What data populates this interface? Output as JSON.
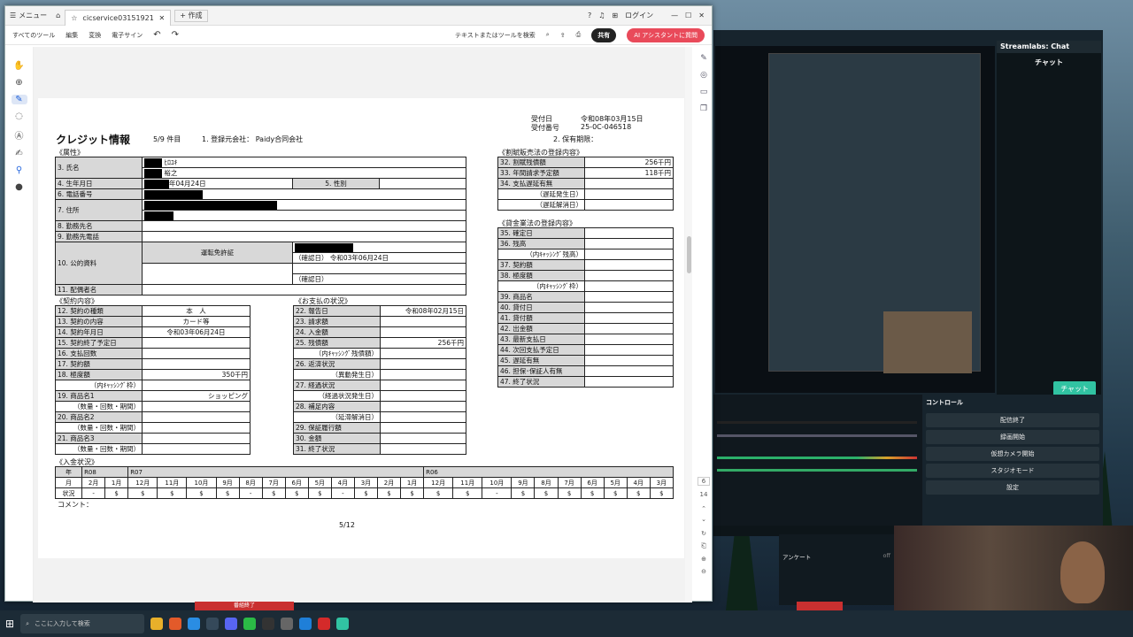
{
  "app": {
    "menu": "メニュー",
    "tab_title": "cicservice031519210...",
    "new_tab": "+ 作成",
    "login": "ログイン"
  },
  "toolbar": {
    "all_tools": "すべてのツール",
    "edit": "編集",
    "convert": "変換",
    "esign": "電子サイン",
    "search": "テキストまたはツールを検索",
    "share": "共有",
    "ai": "AI アシスタントに質問"
  },
  "doc": {
    "title": "クレジット情報",
    "count": "5/9 件目",
    "registrant": "1. 登録元会社： Paidy合同会社",
    "received_date_label": "受付日",
    "received_date": "令和08年03月15日",
    "received_no_label": "受付番号",
    "received_no": "25-0C-046518",
    "retention": "2. 保有期限：",
    "attr_header": "《属性》",
    "name_label": "3. 氏名",
    "name_kana": "ﾋﾛﾕｷ",
    "name_given": "裕之",
    "birth_label": "4. 生年月日",
    "birth": "年04月24日",
    "sex_label": "5. 性別",
    "phone_label": "6. 電話番号",
    "address_label": "7. 住所",
    "work_label": "8. 勤務先名",
    "work_phone_label": "9. 勤務先電話",
    "id_label": "10. 公的資料",
    "id_type": "運転免許証",
    "id_confirm1": "（確認日） 令和03年06月24日",
    "id_confirm2": "（確認日）",
    "spouse_label": "11. 配偶者名",
    "contract_header": "《契約内容》",
    "contract_rows": [
      {
        "k": "12. 契約の種類",
        "v": "本　人",
        "a": "c"
      },
      {
        "k": "13. 契約の内容",
        "v": "カード等",
        "a": "c"
      },
      {
        "k": "14. 契約年月日",
        "v": "令和03年06月24日",
        "a": "c"
      },
      {
        "k": "15. 契約終了予定日",
        "v": "",
        "a": "c"
      },
      {
        "k": "16. 支払回数",
        "v": "",
        "a": "c"
      },
      {
        "k": "17. 契約額",
        "v": "",
        "a": "c"
      },
      {
        "k": "18. 極度額",
        "v": "350千円",
        "a": "r"
      },
      {
        "k": "（内ｷｬｯｼﾝｸﾞ枠）",
        "v": "",
        "a": "r",
        "sub": true
      },
      {
        "k": "19. 商品名1",
        "v": "ショッピング",
        "a": "r"
      },
      {
        "k": "（数量・回数・期間）",
        "v": "",
        "a": "r",
        "sub": true
      },
      {
        "k": "20. 商品名2",
        "v": "",
        "a": "r"
      },
      {
        "k": "（数量・回数・期間）",
        "v": "",
        "a": "r",
        "sub": true
      },
      {
        "k": "21. 商品名3",
        "v": "",
        "a": "r"
      },
      {
        "k": "（数量・回数・期間）",
        "v": "",
        "a": "r",
        "sub": true
      }
    ],
    "payment_header": "《お支払の状況》",
    "payment_rows": [
      {
        "k": "22. 報告日",
        "v": "令和08年02月15日"
      },
      {
        "k": "23. 請求額",
        "v": ""
      },
      {
        "k": "24. 入金額",
        "v": ""
      },
      {
        "k": "25. 残債額",
        "v": "256千円"
      },
      {
        "k": "（内ｷｬｯｼﾝｸﾞ残債額）",
        "v": "",
        "sub": true
      },
      {
        "k": "26. 返済状況",
        "v": ""
      },
      {
        "k": "（異動発生日）",
        "v": "",
        "sub": true
      },
      {
        "k": "27. 経過状況",
        "v": ""
      },
      {
        "k": "（経過状況発生日）",
        "v": "",
        "sub": true
      },
      {
        "k": "28. 補足内容",
        "v": ""
      },
      {
        "k": "（延滞解消日）",
        "v": "",
        "sub": true
      },
      {
        "k": "29. 保証履行額",
        "v": ""
      },
      {
        "k": "30. 金額",
        "v": ""
      },
      {
        "k": "31. 終了状況",
        "v": ""
      }
    ],
    "installment_header": "《割賦販売法の登録内容》",
    "installment_rows": [
      {
        "k": "32. 割賦残債額",
        "v": "256千円"
      },
      {
        "k": "33. 年間請求予定額",
        "v": "118千円"
      },
      {
        "k": "34. 支払遅延有無",
        "v": ""
      },
      {
        "k": "（遅延発生日）",
        "v": "",
        "sub": true
      },
      {
        "k": "（遅延解消日）",
        "v": "",
        "sub": true
      }
    ],
    "lending_header": "《貸金業法の登録内容》",
    "lending_rows": [
      {
        "k": "35. 確定日",
        "v": ""
      },
      {
        "k": "36. 残高",
        "v": ""
      },
      {
        "k": "（内ｷｬｯｼﾝｸﾞ残高）",
        "v": "",
        "sub": true
      },
      {
        "k": "37. 契約額",
        "v": ""
      },
      {
        "k": "38. 極度額",
        "v": ""
      },
      {
        "k": "（内ｷｬｯｼﾝｸﾞ枠）",
        "v": "",
        "sub": true
      },
      {
        "k": "39. 商品名",
        "v": ""
      },
      {
        "k": "40. 貸付日",
        "v": ""
      },
      {
        "k": "41. 貸付額",
        "v": ""
      },
      {
        "k": "42. 出金額",
        "v": ""
      },
      {
        "k": "43. 最新支払日",
        "v": ""
      },
      {
        "k": "44. 次回支払予定日",
        "v": ""
      },
      {
        "k": "45. 遅延有無",
        "v": ""
      },
      {
        "k": "46. 担保･保証人有無",
        "v": ""
      },
      {
        "k": "47. 終了状況",
        "v": ""
      }
    ],
    "deposit_header": "《入金状況》",
    "deposit_year_label": "年",
    "deposit_month_label": "月",
    "deposit_status_label": "状況",
    "years": [
      "R08",
      "R07",
      "R06"
    ],
    "months": [
      "2月",
      "1月",
      "12月",
      "11月",
      "10月",
      "9月",
      "8月",
      "7月",
      "6月",
      "5月",
      "4月",
      "3月",
      "2月",
      "1月",
      "12月",
      "11月",
      "10月",
      "9月",
      "8月",
      "7月",
      "6月",
      "5月",
      "4月",
      "3月"
    ],
    "status": [
      "-",
      "$",
      "$",
      "$",
      "$",
      "$",
      "-",
      "$",
      "$",
      "$",
      "-",
      "$",
      "$",
      "$",
      "$",
      "$",
      "-",
      "$",
      "$",
      "$",
      "$",
      "$",
      "$",
      "$"
    ],
    "comment": "コメント：",
    "page": "5/12"
  },
  "streamlabs": {
    "chat_title": "Streamlabs: Chat",
    "chat_label": "チャット",
    "chat_button": "チャット",
    "controls": "コントロール",
    "buttons": [
      "配信終了",
      "録画開始",
      "仮想カメラ開始",
      "スタジオモード",
      "設定"
    ],
    "status": "ドロップしたフレーム 0 (0.0%)   3222 kbps",
    "anketo": "アンケート",
    "off": "off"
  },
  "taskbar": {
    "search": "ここに入力して検索",
    "notify": "番組終了"
  },
  "side": {
    "page_num": "6",
    "page_total": "14"
  }
}
